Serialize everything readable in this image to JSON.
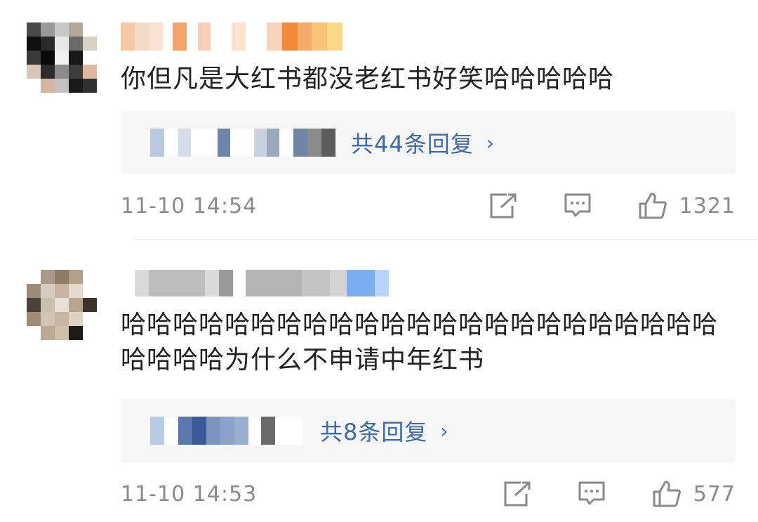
{
  "comments": [
    {
      "text": "你但凡是大红书都没老红书好笑哈哈哈哈哈",
      "reply_link": "共44条回复",
      "timestamp": "11-10 14:54",
      "like_count": "1321"
    },
    {
      "text": "哈哈哈哈哈哈哈哈哈哈哈哈哈哈哈哈哈哈哈哈哈哈哈哈哈哈哈为什么不申请中年红书",
      "reply_link": "共8条回复",
      "timestamp": "11-10 14:53",
      "like_count": "577"
    }
  ],
  "colors": {
    "link": "#3f6aa9",
    "meta_text": "#8a8a8a",
    "reply_bg": "#f6f6f6"
  },
  "icons": [
    "share-icon",
    "comment-icon",
    "like-icon",
    "chevron-right-icon"
  ]
}
